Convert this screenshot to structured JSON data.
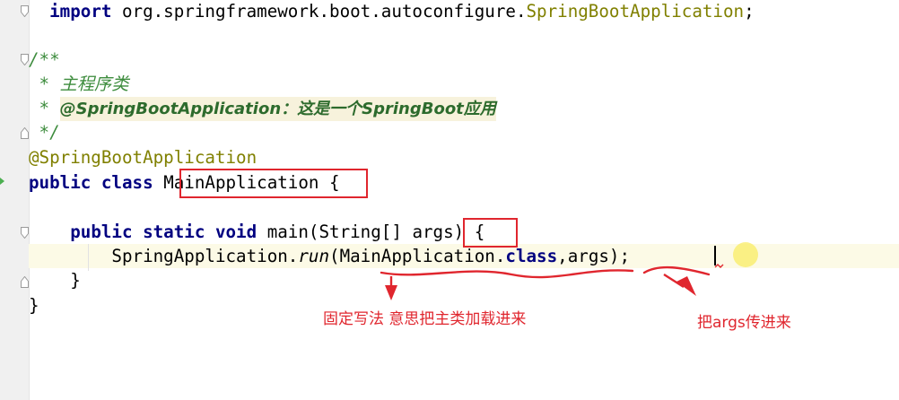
{
  "editor": {
    "lines": {
      "import_kw": "import",
      "import_pkg": " org.springframework.boot.autoconfigure.",
      "import_cls": "SpringBootApplication",
      "import_semi": ";",
      "doc_open": "/**",
      "doc_line1": " *",
      "doc_line1_text": "主程序类",
      "doc_line2": " *",
      "doc_line2_text": "@SpringBootApplication：这是一个SpringBoot应用",
      "doc_close": " */",
      "annotation": "@SpringBootApplication",
      "class_kw": "public class",
      "class_name": "MainApplication",
      "class_open": " {",
      "method_kw": "public static void",
      "method_sig": " main(String[] ",
      "method_args": "args",
      "method_close": ") {",
      "call_prefix": "SpringApplication.",
      "call_run": "run",
      "call_args_open": "(MainApplication.",
      "call_class_kw": "class",
      "call_args_rest": ",args);",
      "close_method": "}",
      "close_class": "}"
    }
  },
  "annotations": {
    "note_fixed": "固定写法 意思把主类加载进来",
    "note_args": "把args传进来",
    "accent_color": "#e0262e"
  }
}
